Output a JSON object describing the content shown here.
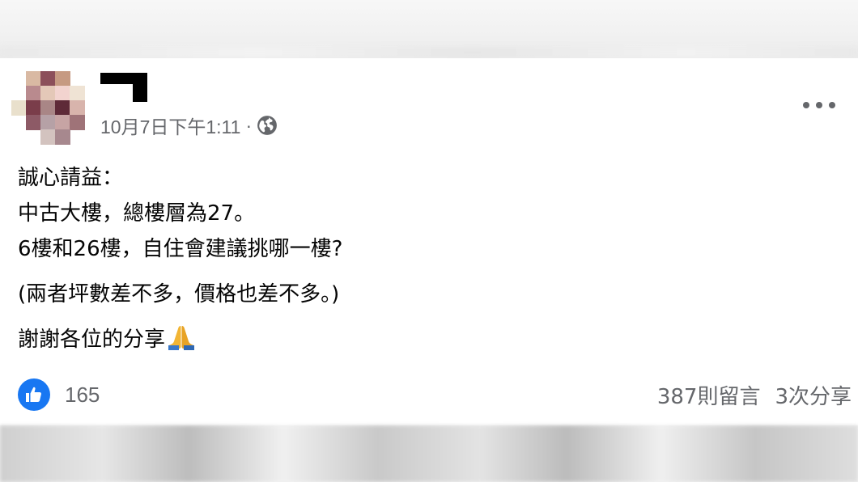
{
  "post": {
    "timestamp": "10月7日下午1:11",
    "separator": "·",
    "privacy_icon": "globe-icon",
    "menu_icon": "more-horizontal-icon",
    "lines": [
      "誠心請益：",
      "中古大樓，總樓層為27。",
      "6樓和26樓，自住會建議挑哪一樓?",
      "(兩者坪數差不多，價格也差不多。)",
      "謝謝各位的分享"
    ],
    "emoji": "folded-hands-emoji"
  },
  "footer": {
    "like_icon": "thumbs-up-icon",
    "like_count": "165",
    "comments": "387則留言",
    "shares": "3次分享"
  },
  "colors": {
    "accent": "#1877f2",
    "secondary_text": "#65676b",
    "text": "#050505"
  }
}
